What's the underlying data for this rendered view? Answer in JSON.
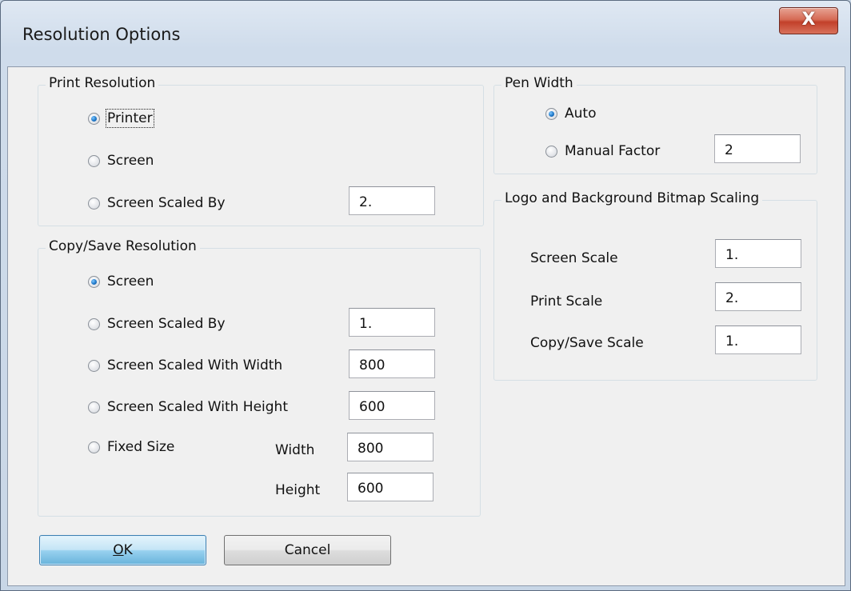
{
  "window": {
    "title": "Resolution Options",
    "close_label": "X"
  },
  "print_resolution": {
    "legend": "Print Resolution",
    "options": [
      {
        "label": "Printer",
        "checked": true
      },
      {
        "label": "Screen",
        "checked": false
      },
      {
        "label": "Screen Scaled By",
        "checked": false
      }
    ],
    "scale_value": "2."
  },
  "copy_save_resolution": {
    "legend": "Copy/Save Resolution",
    "options": [
      {
        "label": "Screen",
        "checked": true
      },
      {
        "label": "Screen Scaled By",
        "checked": false
      },
      {
        "label": "Screen Scaled With Width",
        "checked": false
      },
      {
        "label": "Screen Scaled With Height",
        "checked": false
      },
      {
        "label": "Fixed Size",
        "checked": false
      }
    ],
    "scaled_by_value": "1.",
    "width_value": "800",
    "height_value": "600",
    "fixed_width_label": "Width",
    "fixed_width_value": "800",
    "fixed_height_label": "Height",
    "fixed_height_value": "600"
  },
  "pen_width": {
    "legend": "Pen Width",
    "options": [
      {
        "label": "Auto",
        "checked": true
      },
      {
        "label": "Manual Factor",
        "checked": false
      }
    ],
    "manual_factor_value": "2"
  },
  "bitmap_scaling": {
    "legend": "Logo and Background Bitmap Scaling",
    "screen_scale_label": "Screen Scale",
    "screen_scale_value": "1.",
    "print_scale_label": "Print Scale",
    "print_scale_value": "2.",
    "copy_save_scale_label": "Copy/Save Scale",
    "copy_save_scale_value": "1."
  },
  "buttons": {
    "ok": "OK",
    "cancel": "Cancel"
  }
}
